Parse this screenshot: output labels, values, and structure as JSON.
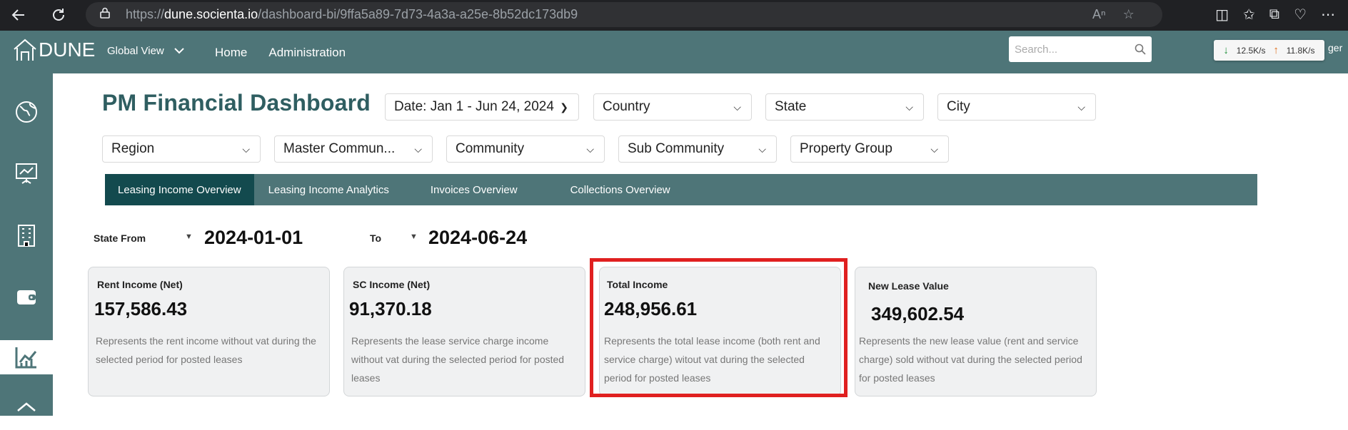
{
  "browser": {
    "url_prefix": "https://",
    "url_domain": "dune.socienta.io",
    "url_path": "/dashboard-bi/9ffa5a89-7d73-4a3a-a25e-8b52dc173db9"
  },
  "header": {
    "logo_text": "DUNE",
    "global_view": "Global View",
    "nav": [
      "Home",
      "Administration"
    ],
    "search_placeholder": "Search...",
    "net_down": "12.5K/s",
    "net_up": "11.8K/s",
    "cut_text": "ger"
  },
  "page": {
    "title": "PM Financial Dashboard"
  },
  "filters": {
    "date": "Date: Jan 1 - Jun 24, 2024",
    "country": "Country",
    "state": "State",
    "city": "City",
    "region": "Region",
    "master_community": "Master Commun...",
    "community": "Community",
    "sub_community": "Sub Community",
    "property_group": "Property Group"
  },
  "tabs": [
    {
      "label": "Leasing Income Overview",
      "active": true
    },
    {
      "label": "Leasing Income Analytics",
      "active": false
    },
    {
      "label": "Invoices Overview",
      "active": false
    },
    {
      "label": "Collections Overview",
      "active": false
    }
  ],
  "date_range": {
    "from_label": "State From",
    "from_value": "2024-01-01",
    "to_label": "To",
    "to_value": "2024-06-24"
  },
  "cards": [
    {
      "title": "Rent Income (Net)",
      "value": "157,586.43",
      "desc": "Represents the rent income without vat during the selected period for posted leases"
    },
    {
      "title": "SC Income (Net)",
      "value": "91,370.18",
      "desc": "Represents the lease service charge income without vat during the selected period for posted leases"
    },
    {
      "title": "Total Income",
      "value": "248,956.61",
      "desc": "Represents the total lease income (both rent and service charge) witout vat during the selected period for posted leases"
    },
    {
      "title": "New Lease Value",
      "value": "349,602.54",
      "desc": "Represents the new lease value (rent and service charge) sold without vat during the selected period for posted leases"
    }
  ],
  "colors": {
    "header_bg": "#4e7578",
    "active_tab": "#134a4e",
    "title": "#2f5e61",
    "highlight": "#e02020"
  }
}
